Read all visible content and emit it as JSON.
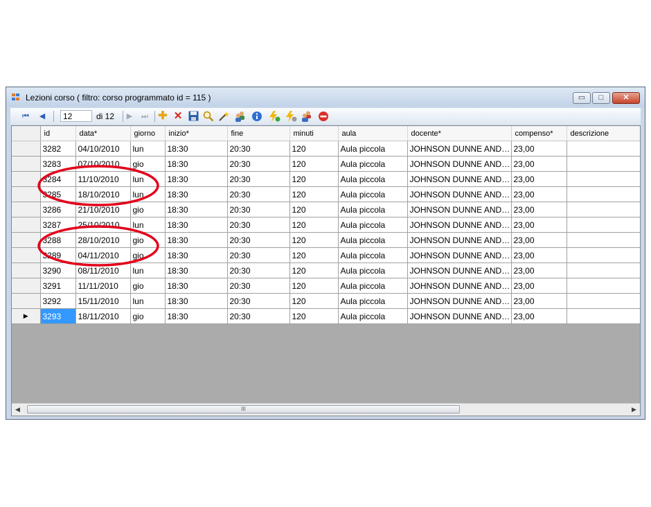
{
  "window": {
    "title": "Lezioni corso ( filtro: corso programmato id = 115 )",
    "minimize_glyph": "▭",
    "maximize_glyph": "□",
    "close_glyph": "✕"
  },
  "toolbar": {
    "position_value": "12",
    "count_label": "di 12",
    "icons": [
      "first-icon",
      "previous-icon",
      "next-icon",
      "last-icon",
      "add-icon",
      "delete-icon",
      "save-icon",
      "search-icon",
      "wand-icon",
      "users-icon",
      "info-icon",
      "lightning-green-icon",
      "lightning-gray-icon",
      "group-icon",
      "stop-icon"
    ]
  },
  "grid": {
    "columns": [
      "id",
      "data*",
      "giorno",
      "inizio*",
      "fine",
      "minuti",
      "aula",
      "docente*",
      "compenso*",
      "descrizione"
    ],
    "rows": [
      [
        "3282",
        "04/10/2010",
        "lun",
        "18:30",
        "20:30",
        "120",
        "Aula piccola",
        "JOHNSON DUNNE ANDR...",
        "23,00",
        ""
      ],
      [
        "3283",
        "07/10/2010",
        "gio",
        "18:30",
        "20:30",
        "120",
        "Aula piccola",
        "JOHNSON DUNNE ANDR...",
        "23,00",
        ""
      ],
      [
        "3284",
        "11/10/2010",
        "lun",
        "18:30",
        "20:30",
        "120",
        "Aula piccola",
        "JOHNSON DUNNE ANDR...",
        "23,00",
        ""
      ],
      [
        "3285",
        "18/10/2010",
        "lun",
        "18:30",
        "20:30",
        "120",
        "Aula piccola",
        "JOHNSON DUNNE ANDR...",
        "23,00",
        ""
      ],
      [
        "3286",
        "21/10/2010",
        "gio",
        "18:30",
        "20:30",
        "120",
        "Aula piccola",
        "JOHNSON DUNNE ANDR...",
        "23,00",
        ""
      ],
      [
        "3287",
        "25/10/2010",
        "lun",
        "18:30",
        "20:30",
        "120",
        "Aula piccola",
        "JOHNSON DUNNE ANDR...",
        "23,00",
        ""
      ],
      [
        "3288",
        "28/10/2010",
        "gio",
        "18:30",
        "20:30",
        "120",
        "Aula piccola",
        "JOHNSON DUNNE ANDR...",
        "23,00",
        ""
      ],
      [
        "3289",
        "04/11/2010",
        "gio",
        "18:30",
        "20:30",
        "120",
        "Aula piccola",
        "JOHNSON DUNNE ANDR...",
        "23,00",
        ""
      ],
      [
        "3290",
        "08/11/2010",
        "lun",
        "18:30",
        "20:30",
        "120",
        "Aula piccola",
        "JOHNSON DUNNE ANDR...",
        "23,00",
        ""
      ],
      [
        "3291",
        "11/11/2010",
        "gio",
        "18:30",
        "20:30",
        "120",
        "Aula piccola",
        "JOHNSON DUNNE ANDR...",
        "23,00",
        ""
      ],
      [
        "3292",
        "15/11/2010",
        "lun",
        "18:30",
        "20:30",
        "120",
        "Aula piccola",
        "JOHNSON DUNNE ANDR...",
        "23,00",
        ""
      ],
      [
        "3293",
        "18/11/2010",
        "gio",
        "18:30",
        "20:30",
        "120",
        "Aula piccola",
        "JOHNSON DUNNE ANDR...",
        "23,00",
        ""
      ]
    ],
    "current_row_index": 11,
    "selection_color": "#3399ff"
  },
  "scrollbar": {
    "thumb_grip": "III"
  },
  "annotation_color": "#e3001b"
}
